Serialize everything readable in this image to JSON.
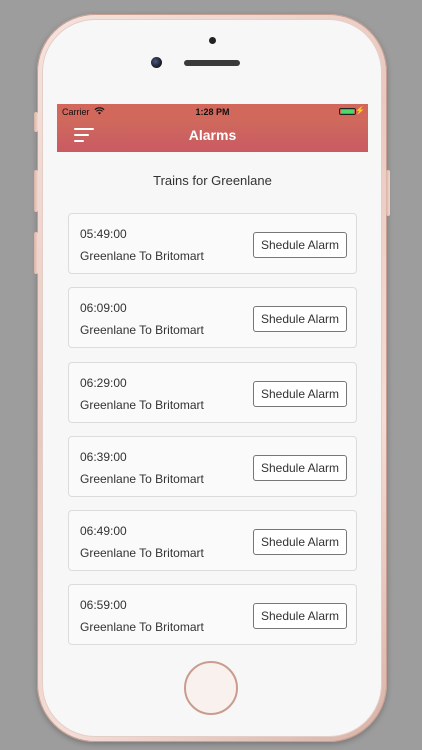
{
  "status_bar": {
    "carrier": "Carrier",
    "time": "1:28 PM",
    "wifi_icon": "wifi-icon",
    "battery_icon": "battery-icon",
    "battery_color": "#4cd964"
  },
  "nav": {
    "title": "Alarms",
    "menu_icon": "hamburger-menu-icon",
    "gradient_top": "#cf6a5c",
    "gradient_bottom": "#c95a63"
  },
  "heading": "Trains for Greenlane",
  "trains": [
    {
      "time": "05:49:00",
      "route": "Greenlane To Britomart",
      "button": "Shedule Alarm"
    },
    {
      "time": "06:09:00",
      "route": "Greenlane To Britomart",
      "button": "Shedule Alarm"
    },
    {
      "time": "06:29:00",
      "route": "Greenlane To Britomart",
      "button": "Shedule Alarm"
    },
    {
      "time": "06:39:00",
      "route": "Greenlane To Britomart",
      "button": "Shedule Alarm"
    },
    {
      "time": "06:49:00",
      "route": "Greenlane To Britomart",
      "button": "Shedule Alarm"
    },
    {
      "time": "06:59:00",
      "route": "Greenlane To Britomart",
      "button": "Shedule Alarm"
    }
  ]
}
